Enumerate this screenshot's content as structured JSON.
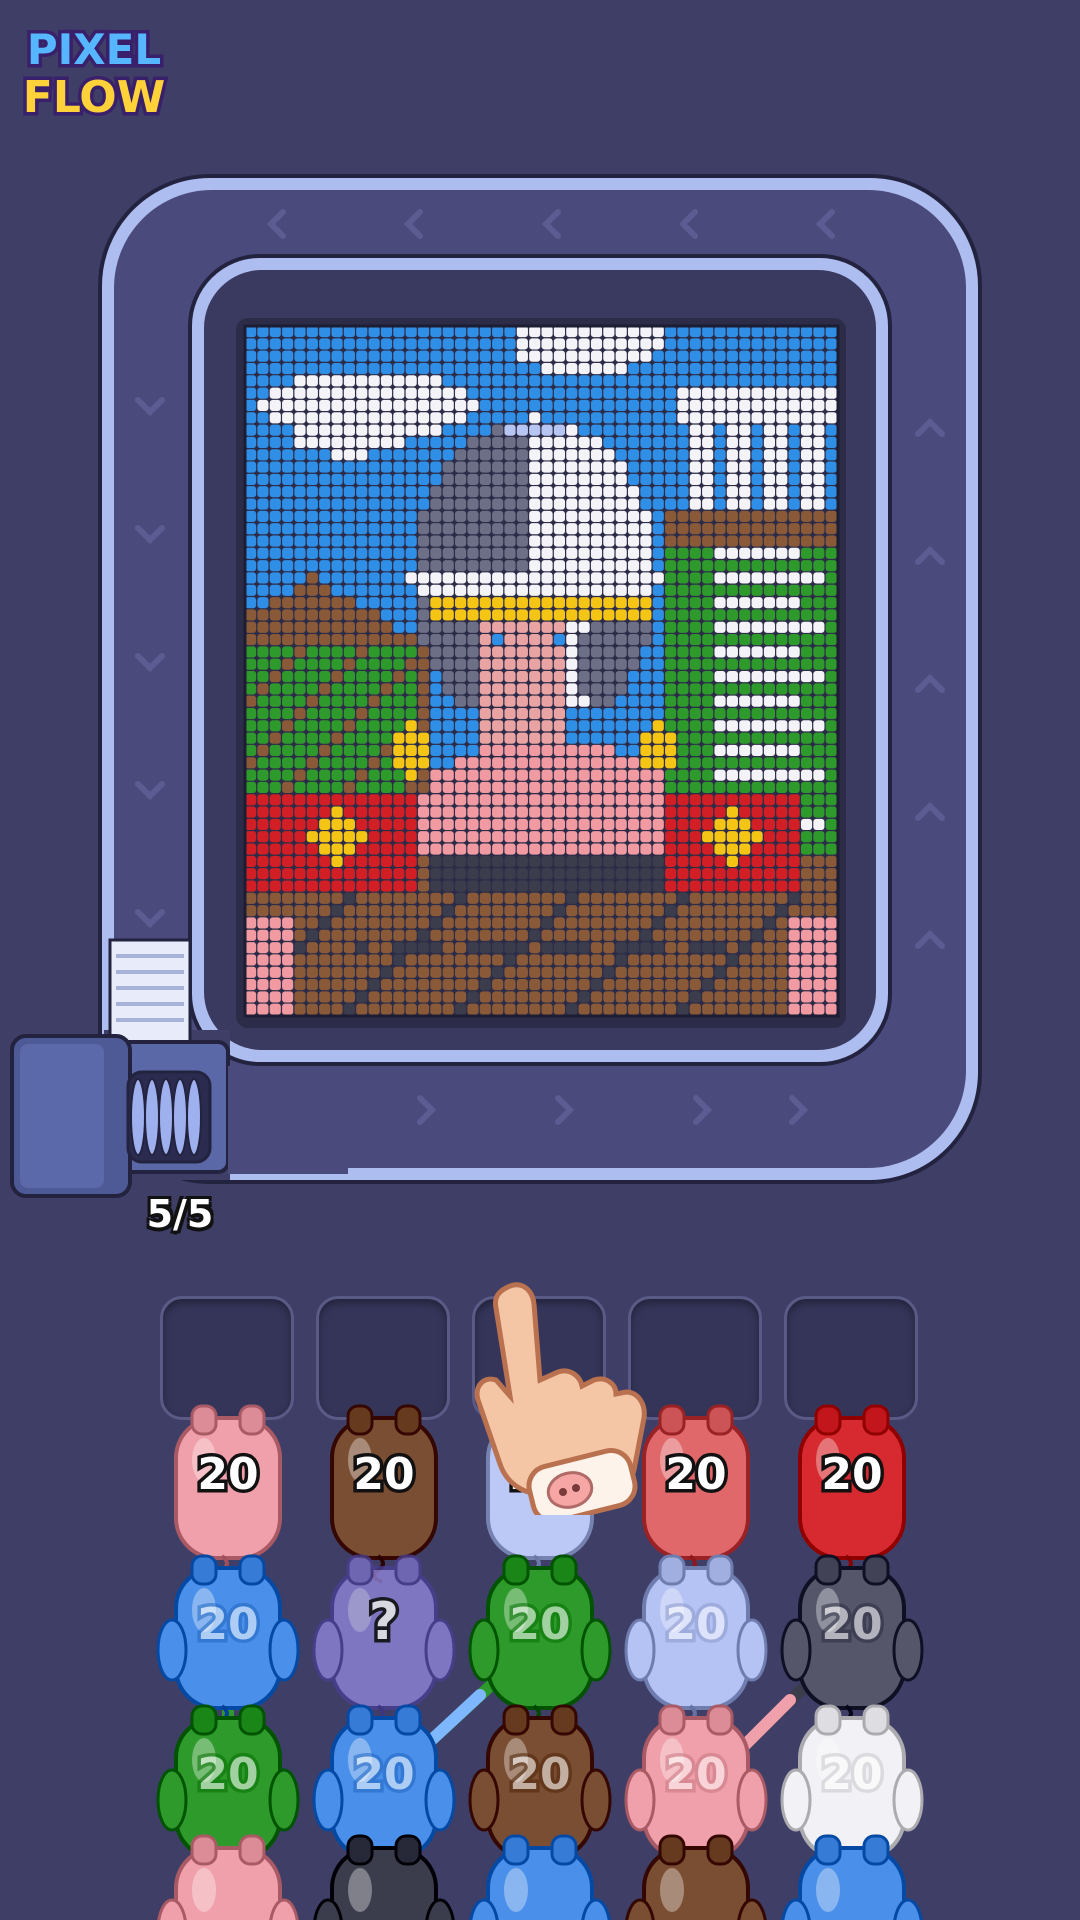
{
  "logo": {
    "line1": "PIXEL",
    "line2": "FLOW"
  },
  "conveyor": {
    "counter": "5/5",
    "palette": {
      "blue": "#2f8fe6",
      "white": "#f4f4f8",
      "lightblue": "#b7c5f2",
      "gray": "#6c6f86",
      "dark": "#3b3d4c",
      "yellow": "#f5c516",
      "pink": "#f19aa2",
      "skin": "#eaa3a3",
      "brown": "#8a5a38",
      "green": "#2f9a2c",
      "red": "#d11f25"
    }
  },
  "slots": [
    {
      "id": 1
    },
    {
      "id": 2
    },
    {
      "id": 3
    },
    {
      "id": 4
    },
    {
      "id": 5
    }
  ],
  "pigs": [
    {
      "row": 0,
      "col": 0,
      "label": "20",
      "color": "#f0a0aa",
      "active": true
    },
    {
      "row": 0,
      "col": 1,
      "label": "20",
      "color": "#7a4e32",
      "active": true
    },
    {
      "row": 0,
      "col": 2,
      "label": "20",
      "color": "#bcc8f6",
      "active": true
    },
    {
      "row": 0,
      "col": 3,
      "label": "20",
      "color": "#e0686a",
      "active": true
    },
    {
      "row": 0,
      "col": 4,
      "label": "20",
      "color": "#d62a30",
      "active": true
    },
    {
      "row": 1,
      "col": 0,
      "label": "20",
      "color": "#4a90ea",
      "active": false
    },
    {
      "row": 1,
      "col": 1,
      "label": "?",
      "color": "#8e84d8",
      "active": false
    },
    {
      "row": 1,
      "col": 2,
      "label": "20",
      "color": "#2f9a2c",
      "active": false
    },
    {
      "row": 1,
      "col": 3,
      "label": "20",
      "color": "#b5c2f4",
      "active": false
    },
    {
      "row": 1,
      "col": 4,
      "label": "20",
      "color": "#55566a",
      "active": false
    },
    {
      "row": 2,
      "col": 0,
      "label": "20",
      "color": "#2f9a2c",
      "active": false
    },
    {
      "row": 2,
      "col": 1,
      "label": "20",
      "color": "#4a90ea",
      "active": false
    },
    {
      "row": 2,
      "col": 2,
      "label": "20",
      "color": "#7a4e32",
      "active": false
    },
    {
      "row": 2,
      "col": 3,
      "label": "20",
      "color": "#f0a0aa",
      "active": false
    },
    {
      "row": 2,
      "col": 4,
      "label": "20",
      "color": "#f2f2f6",
      "active": false
    },
    {
      "row": 3,
      "col": 0,
      "label": "",
      "color": "#f0a0aa",
      "active": false
    },
    {
      "row": 3,
      "col": 1,
      "label": "",
      "color": "#3b3d4c",
      "active": false
    },
    {
      "row": 3,
      "col": 2,
      "label": "",
      "color": "#4a90ea",
      "active": false
    },
    {
      "row": 3,
      "col": 3,
      "label": "",
      "color": "#7a4e32",
      "active": false
    },
    {
      "row": 3,
      "col": 4,
      "label": "",
      "color": "#4a90ea",
      "active": false
    }
  ]
}
